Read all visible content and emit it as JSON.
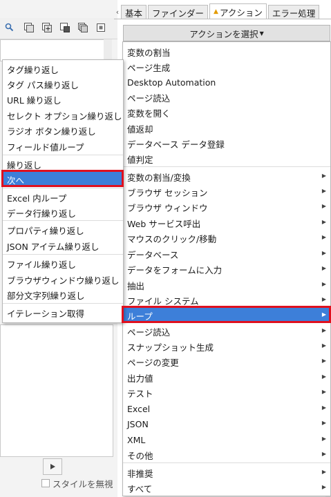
{
  "tabs": [
    {
      "label": "基本",
      "warning": false,
      "active": false
    },
    {
      "label": "ファインダー",
      "warning": false,
      "active": false
    },
    {
      "label": "アクション",
      "warning": true,
      "active": true
    },
    {
      "label": "エラー処理",
      "warning": false,
      "active": false
    }
  ],
  "select_action_label": "アクションを選択",
  "ignore_style_label": "スタイルを無視",
  "action_menu": [
    {
      "label": "変数の割当"
    },
    {
      "label": "ページ生成"
    },
    {
      "label": "Desktop Automation"
    },
    {
      "label": "ページ読込"
    },
    {
      "label": "変数を開く"
    },
    {
      "label": "値返却"
    },
    {
      "label": "データベース データ登録"
    },
    {
      "label": "値判定"
    },
    {
      "label": "変数の割当/変換",
      "submenu": true
    },
    {
      "label": "ブラウザ セッション",
      "submenu": true
    },
    {
      "label": "ブラウザ ウィンドウ",
      "submenu": true
    },
    {
      "label": "Web サービス呼出",
      "submenu": true
    },
    {
      "label": "マウスのクリック/移動",
      "submenu": true
    },
    {
      "label": "データベース",
      "submenu": true
    },
    {
      "label": "データをフォームに入力",
      "submenu": true
    },
    {
      "label": "抽出",
      "submenu": true
    },
    {
      "label": "ファイル システム",
      "submenu": true
    },
    {
      "label": "ループ",
      "submenu": true,
      "selected": true
    },
    {
      "label": "ページ読込",
      "submenu": true
    },
    {
      "label": "スナップショット生成",
      "submenu": true
    },
    {
      "label": "ページの変更",
      "submenu": true
    },
    {
      "label": "出力値",
      "submenu": true
    },
    {
      "label": "テスト",
      "submenu": true
    },
    {
      "label": "Excel",
      "submenu": true
    },
    {
      "label": "JSON",
      "submenu": true
    },
    {
      "label": "XML",
      "submenu": true
    },
    {
      "label": "その他",
      "submenu": true
    },
    {
      "label": "非推奨",
      "submenu": true
    },
    {
      "label": "すべて",
      "submenu": true
    }
  ],
  "loop_submenu": [
    {
      "label": "タグ繰り返し"
    },
    {
      "label": "タグ パス繰り返し"
    },
    {
      "label": "URL 繰り返し"
    },
    {
      "label": "セレクト オプション繰り返し"
    },
    {
      "label": "ラジオ ボタン繰り返し"
    },
    {
      "label": "フィールド値ループ"
    },
    {
      "label": "繰り返し"
    },
    {
      "label": "次へ",
      "selected": true
    },
    {
      "label": "Excel 内ループ"
    },
    {
      "label": "データ行繰り返し"
    },
    {
      "label": "プロパティ繰り返し"
    },
    {
      "label": "JSON アイテム繰り返し"
    },
    {
      "label": "ファイル繰り返し"
    },
    {
      "label": "ブラウザウィンドウ繰り返し"
    },
    {
      "label": "部分文字列繰り返し"
    },
    {
      "label": "イテレーション取得"
    }
  ],
  "colors": {
    "selection": "#3d7fd9",
    "highlight_border": "#e0101e",
    "warning": "#e39b00"
  }
}
